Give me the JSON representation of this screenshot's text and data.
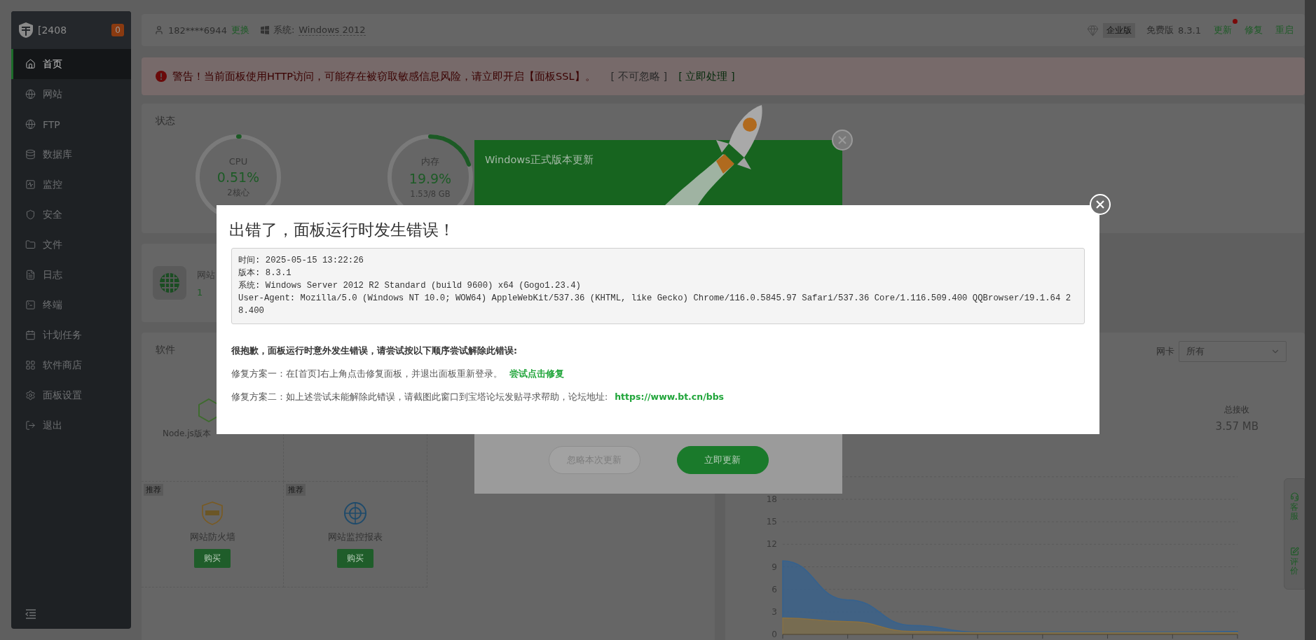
{
  "sidebar": {
    "title": "[2408",
    "badge": "0",
    "items": [
      {
        "label": "首页",
        "selected": true
      },
      {
        "label": "网站",
        "selected": false
      },
      {
        "label": "FTP",
        "selected": false
      },
      {
        "label": "数据库",
        "selected": false
      },
      {
        "label": "监控",
        "selected": false
      },
      {
        "label": "安全",
        "selected": false
      },
      {
        "label": "文件",
        "selected": false
      },
      {
        "label": "日志",
        "selected": false
      },
      {
        "label": "终端",
        "selected": false
      },
      {
        "label": "计划任务",
        "selected": false
      },
      {
        "label": "软件商店",
        "selected": false
      },
      {
        "label": "面板设置",
        "selected": false
      },
      {
        "label": "退出",
        "selected": false
      }
    ]
  },
  "topbar": {
    "user": "182****6944",
    "change": "更换",
    "system_label": "系统:",
    "system": "Windows 2012",
    "edition_badge": "企业版",
    "edition": "免费版",
    "version": "8.3.1",
    "actions": [
      {
        "label": "更新",
        "notify": true
      },
      {
        "label": "修复",
        "notify": false
      },
      {
        "label": "重启",
        "notify": false
      }
    ]
  },
  "warning": {
    "text": "警告！当前面板使用HTTP访问，可能存在被窃取敏感信息风险，请立即开启【面板SSL】。",
    "ignore": "[ 不可忽略 ]",
    "action": "[ 立即处理 ]"
  },
  "status": {
    "title": "状态",
    "gauges": [
      {
        "label": "CPU",
        "value": "0.51%",
        "detail": "2核心",
        "level": 0.0051
      },
      {
        "label": "内存",
        "value": "19.9%",
        "detail": "1.53/8 GB",
        "level": 0.199
      }
    ]
  },
  "sites": {
    "label": "网站",
    "count": "1"
  },
  "software": {
    "title": "软件",
    "featured": "Node.js版本",
    "recommended": [
      {
        "tag": "推荐",
        "name": "网站防火墙",
        "button": "购买"
      },
      {
        "tag": "推荐",
        "name": "网站监控报表",
        "button": "购买"
      }
    ]
  },
  "network": {
    "nic_label": "网卡",
    "nic": "所有",
    "total_label": "总接收",
    "total": "3.57 MB",
    "chart_data": {
      "type": "area",
      "grid": true,
      "ylim": [
        0,
        21
      ],
      "yticks": [
        0,
        3,
        6,
        9,
        12,
        15,
        18
      ],
      "series": [
        {
          "color": "#35628f",
          "values": [
            9.8,
            4.6,
            1.2,
            0.3,
            0.3,
            0.3,
            0.3,
            0.4
          ]
        },
        {
          "color": "#8a7040",
          "values": [
            2.2,
            1.7,
            0.4,
            0.2,
            0.2,
            0.2,
            0.2,
            0.2
          ]
        }
      ]
    }
  },
  "side_float": [
    {
      "label": "客服"
    },
    {
      "label": "评价"
    }
  ],
  "update_dialog": {
    "title": "Windows正式版本更新",
    "buttons": [
      {
        "label": "忽略本次更新",
        "primary": false
      },
      {
        "label": "立即更新",
        "primary": true
      }
    ]
  },
  "error_dialog": {
    "title": "出错了，面板运行时发生错误！",
    "details": [
      "时间: 2025-05-15 13:22:26",
      "版本: 8.3.1",
      "系统: Windows Server 2012 R2 Standard (build 9600) x64 (Gogo1.23.4)",
      "User-Agent: Mozilla/5.0 (Windows NT 10.0; WOW64) AppleWebKit/537.36 (KHTML, like Gecko) Chrome/116.0.5845.97 Safari/537.36 Core/1.116.509.400 QQBrowser/19.1.64 28.400"
    ],
    "apology": "很抱歉，面板运行时意外发生错误，请尝试按以下顺序尝试解除此错误:",
    "fixes": [
      {
        "text": "修复方案一：在[首页]右上角点击修复面板，并退出面板重新登录。",
        "link": "尝试点击修复"
      },
      {
        "text": "修复方案二：如上述尝试未能解除此错误，请截图此窗口到宝塔论坛发贴寻求帮助，论坛地址:",
        "link": "https://www.bt.cn/bbs"
      }
    ]
  }
}
